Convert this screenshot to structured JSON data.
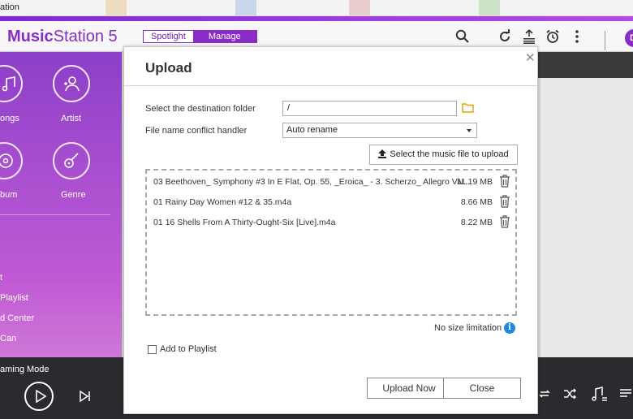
{
  "browser": {
    "title": "ation"
  },
  "app": {
    "logo": {
      "bold": "Music",
      "regular": "Station 5"
    },
    "tabs": [
      "Spotlight",
      "Manage"
    ],
    "active_tab": "Manage",
    "header_icons": [
      "search-icon",
      "refresh-icon",
      "upload-list-icon",
      "alarm-icon",
      "more-vert-icon"
    ],
    "avatar_letter": "D"
  },
  "sidebar": {
    "tiles": [
      {
        "label": "ongs",
        "icon": "music-note-icon"
      },
      {
        "label": "Artist",
        "icon": "artist-icon"
      },
      {
        "label": "bum",
        "icon": "album-icon"
      },
      {
        "label": "Genre",
        "icon": "guitar-icon"
      }
    ],
    "items": [
      "t",
      "Playlist",
      "d Center",
      "Can"
    ]
  },
  "player": {
    "mode_label": "aming Mode",
    "icons": [
      "play-icon",
      "next-icon",
      "repeat-icon",
      "shuffle-icon",
      "lyrics-icon",
      "queue-icon"
    ]
  },
  "upload_dialog": {
    "title": "Upload",
    "close_icon": "close-icon",
    "destination_label": "Select the destination folder",
    "destination_value": "/",
    "conflict_label": "File name conflict handler",
    "conflict_value": "Auto rename",
    "select_button": "Select the music file to upload",
    "files": [
      {
        "name": "03 Beethoven_ Symphony #3 In E Flat, Op. 55, _Eroica_ - 3. Scherzo_ Allegro Viv...",
        "size": "11.19 MB"
      },
      {
        "name": "01 Rainy Day Women #12 & 35.m4a",
        "size": "8.66 MB"
      },
      {
        "name": "01 16 Shells From A Thirty-Ought-Six [Live].m4a",
        "size": "8.22 MB"
      }
    ],
    "size_limit_text": "No size limitation",
    "add_to_playlist_label": "Add to Playlist",
    "add_to_playlist_checked": false,
    "upload_button": "Upload Now",
    "close_button": "Close"
  },
  "colors": {
    "accent": "#8a2bc8",
    "info": "#1e88e5",
    "folder": "#e8a000"
  }
}
